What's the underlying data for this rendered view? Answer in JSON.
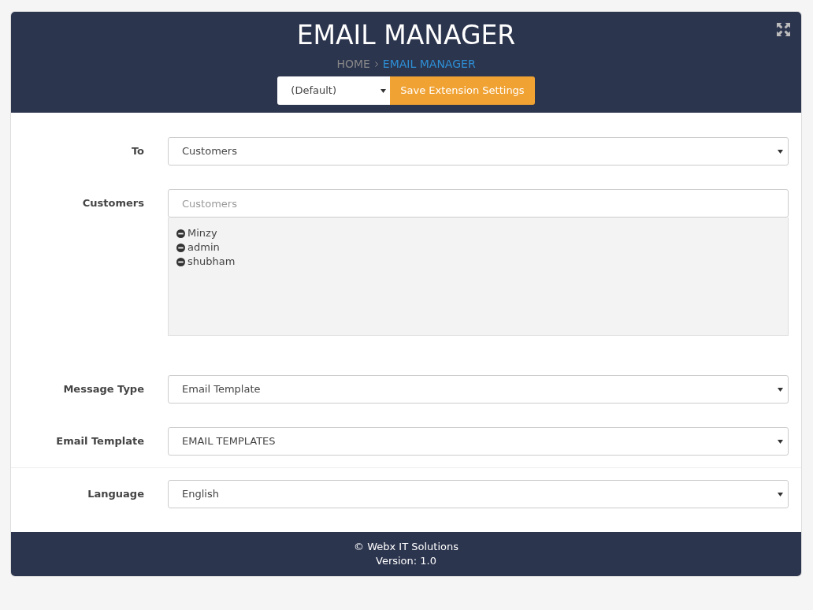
{
  "header": {
    "title": "EMAIL MANAGER",
    "breadcrumb": [
      {
        "label": "HOME",
        "selected": false
      },
      {
        "label": "EMAIL MANAGER",
        "selected": true
      }
    ],
    "profile_select": {
      "value": "(Default)"
    },
    "save_button": "Save Extension Settings"
  },
  "form": [
    {
      "kind": "select",
      "label": "To",
      "value": "Customers"
    },
    {
      "kind": "search",
      "label": "Customers",
      "placeholder": "Customers",
      "items": [
        "Minzy",
        "admin",
        "shubham"
      ]
    },
    {
      "kind": "select",
      "label": "Message Type",
      "value": "Email Template"
    },
    {
      "kind": "select",
      "label": "Email Template",
      "value": "EMAIL TEMPLATES"
    },
    {
      "kind": "select",
      "label": "Language",
      "value": "English"
    }
  ],
  "footer": {
    "copyright": "© Webx IT Solutions",
    "version": "Version: 1.0"
  }
}
